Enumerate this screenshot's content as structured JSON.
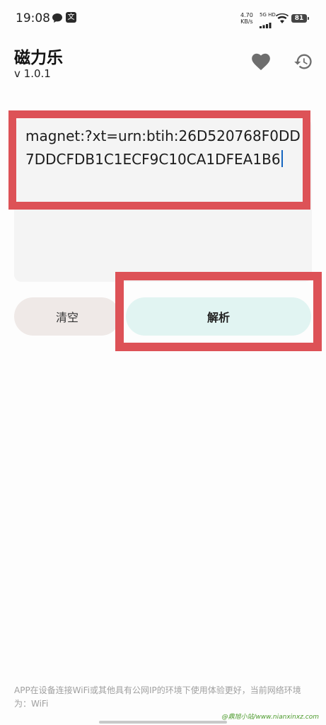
{
  "status_bar": {
    "time": "19:08",
    "app_badge": "文",
    "net_speed_value": "4.70",
    "net_speed_unit": "KB/s",
    "network_label": "5G HD",
    "battery": "81"
  },
  "header": {
    "title": "磁力乐",
    "version": "v 1.0.1",
    "favorite_icon": "heart-icon",
    "history_icon": "history-icon"
  },
  "input": {
    "value": "magnet:?xt=urn:btih:26D520768F0DD7DDCFDB1C1ECF9C10CA1DFEA1B6"
  },
  "actions": {
    "clear_label": "清空",
    "parse_label": "解析"
  },
  "footer": {
    "note": "APP在设备连接WiFi或其他具有公网IP的环境下使用体验更好，当前网络环境为：WiFi"
  },
  "watermark": "@鼎旭小站/www.nianxinxz.com",
  "colors": {
    "highlight": "#dd5257",
    "clear_button_bg": "#efe9e7",
    "parse_button_bg": "#e1f4f2",
    "cursor": "#1565c0"
  }
}
